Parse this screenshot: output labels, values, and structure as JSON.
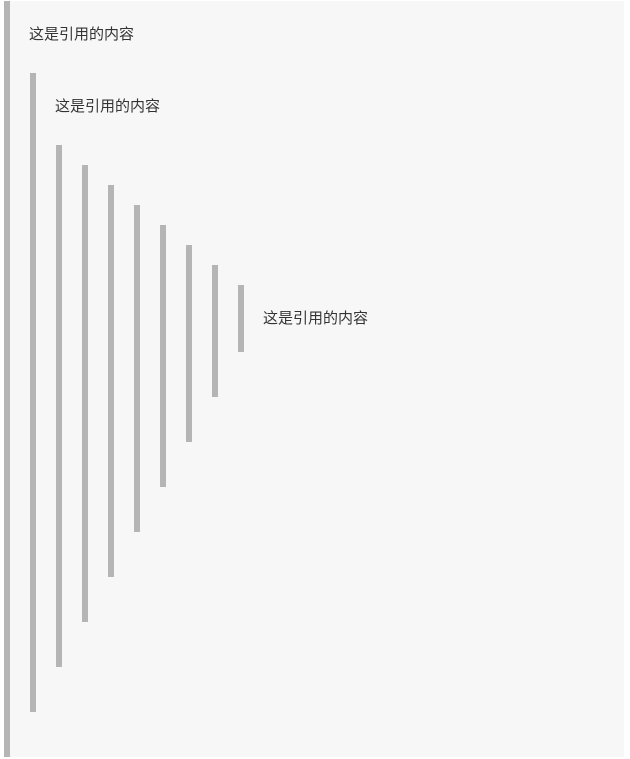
{
  "quotes": {
    "level1_text": "这是引用的内容",
    "level2_text": "这是引用的内容",
    "innermost_text": "这是引用的内容"
  },
  "colors": {
    "background": "#f7f7f7",
    "bar": "#b5b5b5",
    "text": "#333333"
  }
}
